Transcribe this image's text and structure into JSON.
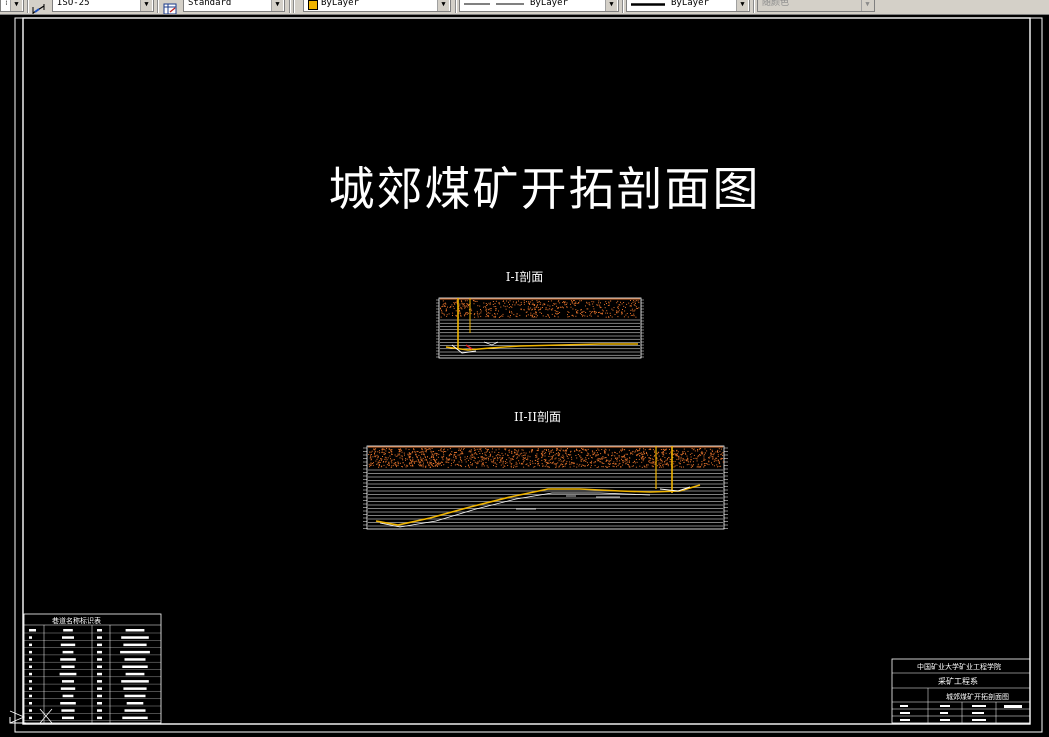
{
  "toolbar": {
    "dimstyle_value": "ISO-25",
    "tablestyle_value": "Standard",
    "layer_color_value": "ByLayer",
    "linetype_value": "ByLayer",
    "lineweight_value": "ByLayer",
    "plotstyle_value": "随颜色",
    "layer_color_swatch": "#f0b400"
  },
  "drawing": {
    "main_title": "城郊煤矿开拓剖面图",
    "section1_title": "I-I剖面",
    "section2_title": "II-II剖面",
    "legend_table_title": "巷道名称标识表",
    "titleblock": {
      "institution": "中国矿业大学矿业工程学院",
      "department": "采矿工程系",
      "drawing_name": "城郊煤矿开拓剖面图"
    },
    "colors": {
      "background": "#000000",
      "frame": "#ffffff",
      "rock": "#e0702a",
      "roadway": "#f0b400"
    }
  }
}
